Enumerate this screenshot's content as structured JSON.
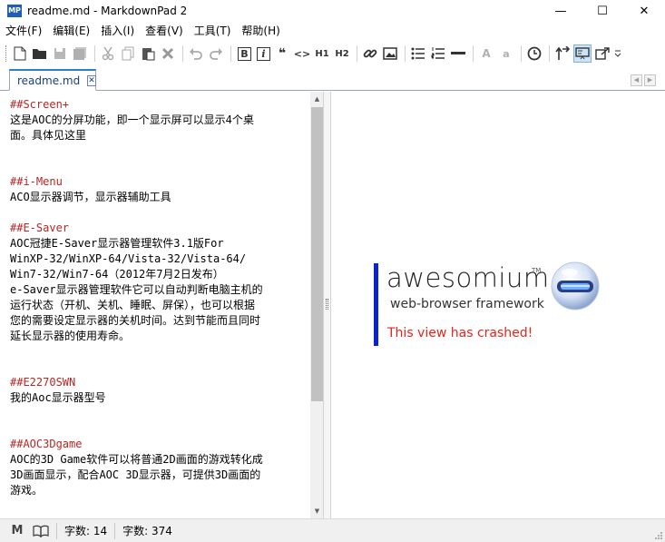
{
  "window": {
    "app_icon": "MP",
    "title": "readme.md - MarkdownPad 2",
    "minimize_glyph": "—",
    "maximize_glyph": "☐",
    "close_glyph": "✕"
  },
  "menu": [
    "文件(F)",
    "编辑(E)",
    "插入(I)",
    "查看(V)",
    "工具(T)",
    "帮助(H)"
  ],
  "toolbar": {
    "bold": "B",
    "italic": "i",
    "quote": "❝",
    "code": "<>",
    "h1": "H1",
    "h2": "H2",
    "upper_a": "A",
    "lower_a": "a"
  },
  "tab": {
    "label": "readme.md",
    "close_glyph": "✕"
  },
  "editor": {
    "lines": [
      {
        "text": "##Screen+",
        "heading": true
      },
      {
        "text": "这是AOC的分屏功能，即一个显示屏可以显示4个桌",
        "heading": false
      },
      {
        "text": "面。具体见这里",
        "heading": false
      },
      {
        "text": "",
        "heading": false
      },
      {
        "text": "",
        "heading": false
      },
      {
        "text": "##i-Menu",
        "heading": true
      },
      {
        "text": "ACO显示器调节，显示器辅助工具",
        "heading": false
      },
      {
        "text": "",
        "heading": false
      },
      {
        "text": "##E-Saver",
        "heading": true
      },
      {
        "text": "AOC冠捷E-Saver显示器管理软件3.1版For",
        "heading": false
      },
      {
        "text": "WinXP-32/WinXP-64/Vista-32/Vista-64/",
        "heading": false
      },
      {
        "text": "Win7-32/Win7-64（2012年7月2日发布）",
        "heading": false
      },
      {
        "text": "e-Saver显示器管理软件它可以自动判断电脑主机的",
        "heading": false
      },
      {
        "text": "运行状态（开机、关机、睡眠、屏保），也可以根据",
        "heading": false
      },
      {
        "text": "您的需要设定显示器的关机时间。达到节能而且同时",
        "heading": false
      },
      {
        "text": "延长显示器的使用寿命。",
        "heading": false
      },
      {
        "text": "",
        "heading": false
      },
      {
        "text": "",
        "heading": false
      },
      {
        "text": "##E2270SWN",
        "heading": true
      },
      {
        "text": "我的Aoc显示器型号",
        "heading": false
      },
      {
        "text": "",
        "heading": false
      },
      {
        "text": "",
        "heading": false
      },
      {
        "text": "##AOC3Dgame",
        "heading": true
      },
      {
        "text": "AOC的3D Game软件可以将普通2D画面的游戏转化成",
        "heading": false
      },
      {
        "text": "3D画面显示，配合AOC 3D显示器，可提供3D画面的",
        "heading": false
      },
      {
        "text": "游戏。",
        "heading": false
      }
    ],
    "scroll_position": 0.0
  },
  "preview": {
    "logo_text": "awesomium",
    "trademark": "TM",
    "subtitle": "web-browser framework",
    "crash_message": "This view has crashed!",
    "accent_color": "#0b23cf",
    "crash_color": "#e5231b"
  },
  "statusbar": {
    "markdown_icon": "M",
    "words": "字数: 14",
    "chars": "字数:  374"
  }
}
